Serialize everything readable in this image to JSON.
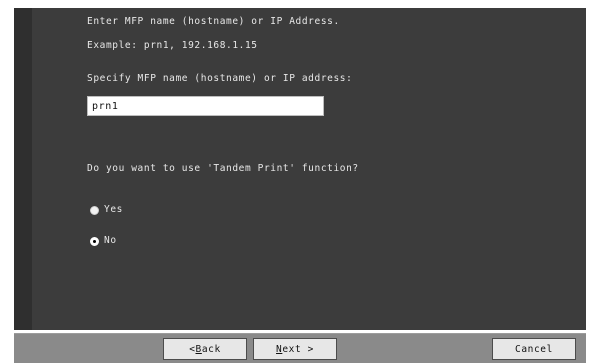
{
  "wizard": {
    "instruction": "Enter MFP name (hostname) or IP Address.",
    "example": "Example: prn1, 192.168.1.15",
    "host_label": "Specify MFP name (hostname) or IP address:",
    "host_value": "prn1",
    "tandem_question": "Do you want to use 'Tandem Print' function?",
    "options": [
      {
        "label": "Yes",
        "selected": false
      },
      {
        "label": "No",
        "selected": true
      }
    ]
  },
  "footer": {
    "back_prefix": "< ",
    "back_key": "B",
    "back_rest": "ack",
    "next_key": "N",
    "next_rest": "ext >",
    "cancel_label": "Cancel"
  }
}
